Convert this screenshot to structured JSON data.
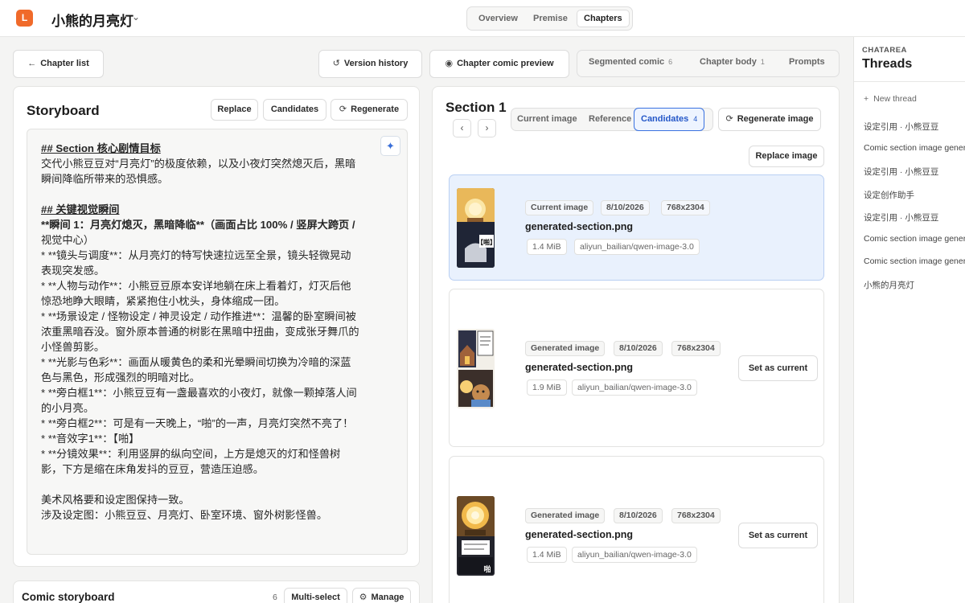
{
  "app": {
    "logo_letter": "L",
    "project_title": "小熊的月亮灯",
    "top_tabs": [
      "Overview",
      "Premise",
      "Chapters"
    ],
    "active_top_tab": "Chapters"
  },
  "header": {
    "back_label": "Chapter list",
    "version_history_label": "Version history",
    "comic_preview_label": "Chapter comic preview",
    "tabs": [
      {
        "label": "Segmented comic",
        "count": "6"
      },
      {
        "label": "Chapter body",
        "count": "1"
      },
      {
        "label": "Prompts",
        "count": ""
      }
    ]
  },
  "storyboard": {
    "title": "Storyboard",
    "replace_label": "Replace",
    "candidates_label": "Candidates",
    "regenerate_label": "Regenerate",
    "lines": [
      "## Section 核心剧情目标",
      "交代小熊豆豆对“月亮灯”的极度依赖，以及小夜灯突然熄灭后，黑暗",
      "瞬间降临所带来的恐惧感。",
      "",
      "## 关键视觉瞬间",
      "**瞬间 1：月亮灯熄灭，黑暗降临**（画面占比 100% / 竖屏大跨页 /",
      "视觉中心）",
      "* **镜头与调度**：从月亮灯的特写快速拉远至全景，镜头轻微晃动",
      "表现突发感。",
      "* **人物与动作**：小熊豆豆原本安详地躺在床上看着灯，灯灭后他",
      "惊恐地睁大眼睛，紧紧抱住小枕头，身体缩成一团。",
      "* **场景设定 / 怪物设定 / 神灵设定 / 动作推进**：温馨的卧室瞬间被",
      "浓重黑暗吞没。窗外原本普通的树影在黑暗中扭曲，变成张牙舞爪的",
      "小怪兽剪影。",
      "* **光影与色彩**：画面从暖黄色的柔和光晕瞬间切换为冷暗的深蓝",
      "色与黑色，形成强烈的明暗对比。",
      "* **旁白框1**：小熊豆豆有一盏最喜欢的小夜灯，就像一颗掉落人间",
      "的小月亮。",
      "* **旁白框2**：可是有一天晚上，“啪”的一声，月亮灯突然不亮了！",
      "* **音效字1**：【啪】",
      "* **分镜效果**：利用竖屏的纵向空间，上方是熄灭的灯和怪兽树",
      "影，下方是缩在床角发抖的豆豆，营造压迫感。",
      "",
      "美术风格要和设定图保持一致。",
      "涉及设定图：小熊豆豆、月亮灯、卧室环境、窗外树影怪兽。"
    ]
  },
  "comic_storyboard": {
    "title": "Comic storyboard",
    "count": "6",
    "multiselect_label": "Multi-select",
    "manage_label": "Manage"
  },
  "section": {
    "title": "Section 1",
    "tabs": [
      {
        "label": "Current image",
        "count": ""
      },
      {
        "label": "Reference",
        "count": ""
      },
      {
        "label": "Candidates",
        "count": "4"
      }
    ],
    "regenerate_image_label": "Regenerate image",
    "replace_image_label": "Replace image",
    "set_current_label": "Set as current",
    "cards": [
      {
        "tag": "Current image",
        "date": "8/10/2026",
        "dims": "768x2304",
        "filename": "generated-section.png",
        "size": "1.4 MiB",
        "model": "aliyun_bailian/qwen-image-3.0",
        "thumb_text": "【啪】"
      },
      {
        "tag": "Generated image",
        "date": "8/10/2026",
        "dims": "768x2304",
        "filename": "generated-section.png",
        "size": "1.9 MiB",
        "model": "aliyun_bailian/qwen-image-3.0",
        "thumb_text": ""
      },
      {
        "tag": "Generated image",
        "date": "8/10/2026",
        "dims": "768x2304",
        "filename": "generated-section.png",
        "size": "1.4 MiB",
        "model": "aliyun_bailian/qwen-image-3.0",
        "thumb_text": "啪"
      }
    ]
  },
  "threads": {
    "overline": "CHATAREA",
    "title": "Threads",
    "new_thread_label": "New thread",
    "items": [
      "设定引用 · 小熊豆豆",
      "Comic section image generation",
      "设定引用 · 小熊豆豆",
      "设定创作助手",
      "设定引用 · 小熊豆豆",
      "Comic section image generation",
      "Comic section image generation",
      "小熊的月亮灯"
    ]
  },
  "colors": {
    "accent": "#3a72e0",
    "logo": "#f06a2a",
    "selected_card_bg": "#e9f1fd"
  }
}
